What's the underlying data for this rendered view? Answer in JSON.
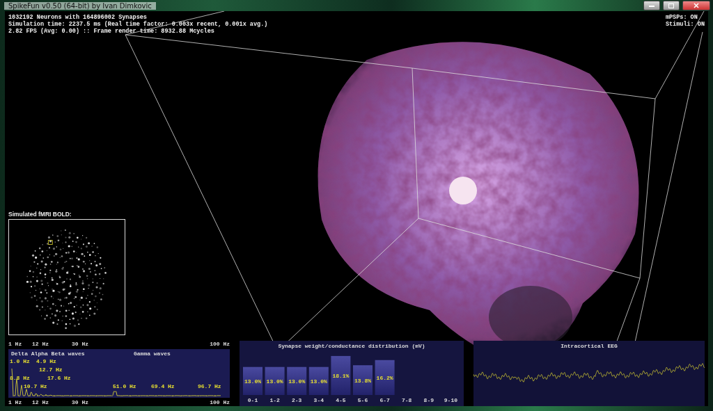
{
  "window": {
    "title": "SpikeFun v0.50 (64-bit) by Ivan Dimkovic"
  },
  "stats": [
    "1032192 Neurons with 164896002 Synapses",
    "Simulation time: 2237.5 ms (Real time factor: 0.003x recent, 0.001x avg.)",
    "2.82 FPS (Avg: 0.00) :: Frame render time: 8932.88 Mcycles"
  ],
  "status": [
    "mPSPs: ON",
    "Stimuli: ON"
  ],
  "fmri": {
    "title": "Simulated fMRI BOLD:"
  },
  "spectrum": {
    "top_ticks": [
      "1 Hz",
      "12 Hz",
      "30 Hz",
      "100 Hz"
    ],
    "bands": [
      "Delta Alpha Beta waves",
      "Gamma waves"
    ],
    "peaks": [
      "1.0 Hz",
      "4.9 Hz",
      "12.7 Hz",
      "8.8 Hz",
      "17.6 Hz",
      "10.7 Hz",
      "51.0 Hz",
      "69.4 Hz",
      "96.7 Hz"
    ],
    "bottom_ticks": [
      "1 Hz",
      "12 Hz",
      "30 Hz",
      "100 Hz"
    ]
  },
  "histogram": {
    "chart_data": {
      "type": "bar",
      "title": "Synapse weight/conductance distribution (mV)",
      "categories": [
        "0-1",
        "1-2",
        "2-3",
        "3-4",
        "4-5",
        "5-6",
        "6-7",
        "7-8",
        "8-9",
        "9-10"
      ],
      "values": [
        13.0,
        13.0,
        13.0,
        13.0,
        18.1,
        13.8,
        16.2,
        null,
        null,
        null
      ],
      "value_labels": [
        "13.0%",
        "13.0%",
        "13.0%",
        "13.0%",
        "18.1%",
        "13.8%",
        "16.2%",
        null,
        null,
        null
      ]
    }
  },
  "eeg": {
    "title": "Intracortical EEG"
  }
}
